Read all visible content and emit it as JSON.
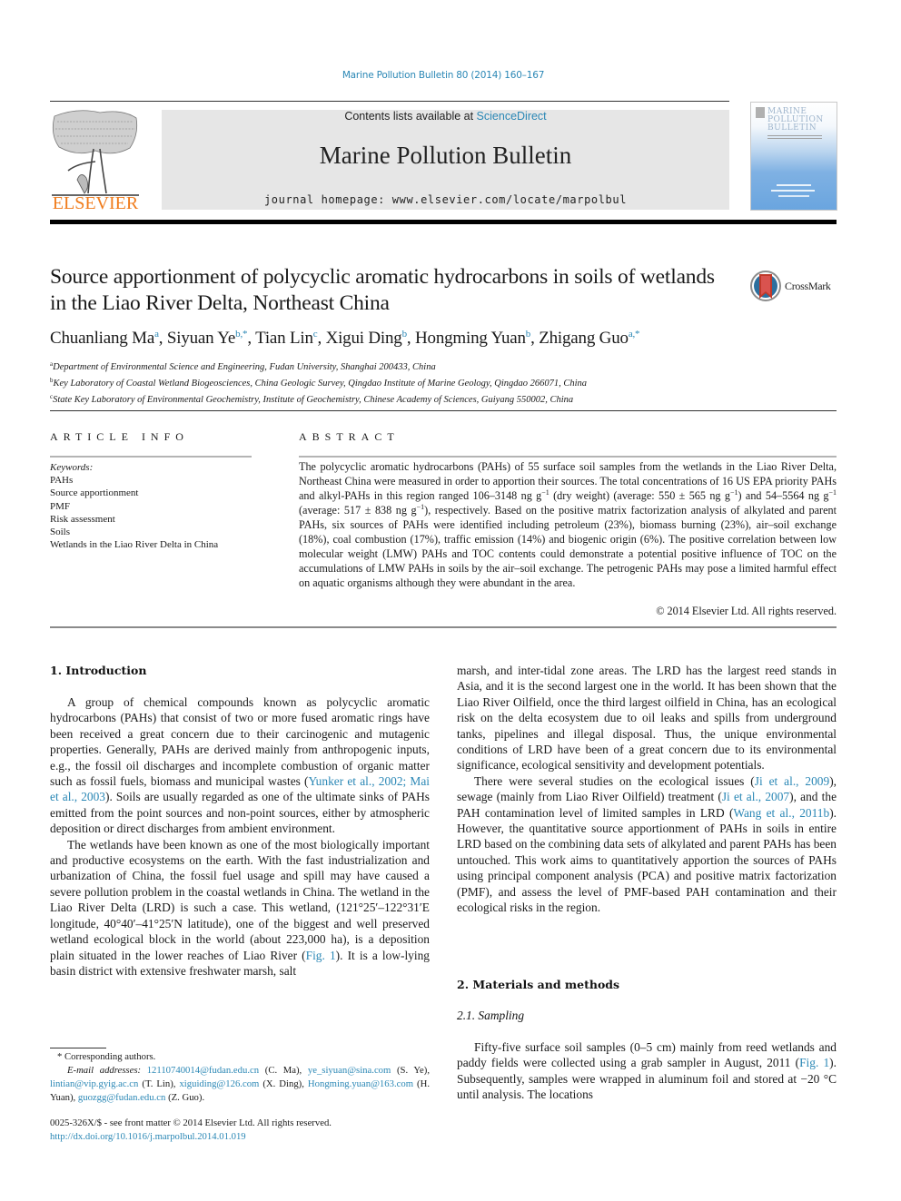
{
  "header": {
    "citation": "Marine Pollution Bulletin 80 (2014) 160–167",
    "contents_prefix": "Contents lists available at ",
    "contents_link": "ScienceDirect",
    "journal_title": "Marine Pollution Bulletin",
    "homepage": "journal homepage: www.elsevier.com/locate/marpolbul",
    "publisher_logo_text": "ELSEVIER",
    "cover_title": "MARINE\nPOLLUTION\nBULLETIN",
    "colors": {
      "link": "#2a87b5",
      "elsevier_orange": "#f07c1c",
      "masthead_bg": "#e6e6e6"
    }
  },
  "article": {
    "title": "Source apportionment of polycyclic aromatic hydrocarbons in soils of wetlands in the Liao River Delta, Northeast China",
    "crossmark_label": "CrossMark",
    "authors": [
      {
        "name": "Chuanliang Ma",
        "sup": "a",
        "sep": ", "
      },
      {
        "name": "Siyuan Ye",
        "sup": "b,*",
        "sep": ", "
      },
      {
        "name": "Tian Lin",
        "sup": "c",
        "sep": ", "
      },
      {
        "name": "Xigui Ding",
        "sup": "b",
        "sep": ", "
      },
      {
        "name": "Hongming Yuan",
        "sup": "b",
        "sep": ", "
      },
      {
        "name": "Zhigang Guo",
        "sup": "a,*",
        "sep": ""
      }
    ],
    "affiliations": [
      {
        "key": "a",
        "text": "Department of Environmental Science and Engineering, Fudan University, Shanghai 200433, China"
      },
      {
        "key": "b",
        "text": "Key Laboratory of Coastal Wetland Biogeosciences, China Geologic Survey, Qingdao Institute of Marine Geology, Qingdao 266071, China"
      },
      {
        "key": "c",
        "text": "State Key Laboratory of Environmental Geochemistry, Institute of Geochemistry, Chinese Academy of Sciences, Guiyang 550002, China"
      }
    ]
  },
  "article_info": {
    "heading": "ARTICLE INFO",
    "keywords_label": "Keywords:",
    "keywords": [
      "PAHs",
      "Source apportionment",
      "PMF",
      "Risk assessment",
      "Soils",
      "Wetlands in the Liao River Delta in China"
    ]
  },
  "abstract": {
    "heading": "ABSTRACT",
    "parts": [
      "The polycyclic aromatic hydrocarbons (PAHs) of 55 surface soil samples from the wetlands in the Liao River Delta, Northeast China were measured in order to apportion their sources. The total concentrations of 16 US EPA priority PAHs and alkyl-PAHs in this region ranged 106–3148 ng g",
      "(dry weight) (average: 550 ± 565 ng g",
      ") and 54–5564 ng g",
      "(average: 517 ± 838 ng g",
      "), respectively. Based on the positive matrix factorization analysis of alkylated and parent PAHs, six sources of PAHs were identified including petroleum (23%), biomass burning (23%), air–soil exchange (18%), coal combustion (17%), traffic emission (14%) and biogenic origin (6%). The positive correlation between low molecular weight (LMW) PAHs and TOC contents could demonstrate a potential positive influence of TOC on the accumulations of LMW PAHs in soils by the air–soil exchange. The petrogenic PAHs may pose a limited harmful effect on aquatic organisms although they were abundant in the area."
    ],
    "unit_sup": "−1",
    "copyright": "© 2014 Elsevier Ltd. All rights reserved."
  },
  "body": {
    "intro_heading": "1. Introduction",
    "intro_p1": [
      "A group of chemical compounds known as polycyclic aromatic hydrocarbons (PAHs) that consist of two or more fused aromatic rings have been received a great concern due to their carcinogenic and mutagenic properties. Generally, PAHs are derived mainly from anthropogenic inputs, e.g., the fossil oil discharges and incomplete combustion of organic matter such as fossil fuels, biomass and municipal wastes (",
      "Yunker et al., 2002; Mai et al., 2003",
      "). Soils are usually regarded as one of the ultimate sinks of PAHs emitted from the point sources and non-point sources, either by atmospheric deposition or direct discharges from ambient environment."
    ],
    "intro_p2": [
      "The wetlands have been known as one of the most biologically important and productive ecosystems on the earth. With the fast industrialization and urbanization of China, the fossil fuel usage and spill may have caused a severe pollution problem in the coastal wetlands in China. The wetland in the Liao River Delta (LRD) is such a case. This wetland, (121°25′–122°31′E longitude, 40°40′–41°25′N latitude), one of the biggest and well preserved wetland ecological block in the world (about 223,000 ha), is a deposition plain situated in the lower reaches of Liao River (",
      "Fig. 1",
      "). It is a low-lying basin district with extensive freshwater marsh, salt"
    ],
    "right_p1": "marsh, and inter-tidal zone areas. The LRD has the largest reed stands in Asia, and it is the second largest one in the world. It has been shown that the Liao River Oilfield, once the third largest oilfield in China, has an ecological risk on the delta ecosystem due to oil leaks and spills from underground tanks, pipelines and illegal disposal. Thus, the unique environmental conditions of LRD have been of a great concern due to its environmental significance, ecological sensitivity and development potentials.",
    "right_p2": [
      "There were several studies on the ecological issues (",
      "Ji et al., 2009",
      "), sewage (mainly from Liao River Oilfield) treatment (",
      "Ji et al., 2007",
      "), and the PAH contamination level of limited samples in LRD (",
      "Wang et al., 2011b",
      "). However, the quantitative source apportionment of PAHs in soils in entire LRD based on the combining data sets of alkylated and parent PAHs has been untouched. This work aims to quantitatively apportion the sources of PAHs using principal component analysis (PCA) and positive matrix factorization (PMF), and assess the level of PMF-based PAH contamination and their ecological risks in the region."
    ],
    "methods_heading": "2. Materials and methods",
    "sampling_heading": "2.1. Sampling",
    "sampling_p1": [
      "Fifty-five surface soil samples (0–5 cm) mainly from reed wetlands and paddy fields were collected using a grab sampler in August, 2011 (",
      "Fig. 1",
      "). Subsequently, samples were wrapped in aluminum foil and stored at −20 °C until analysis. The locations"
    ]
  },
  "footnotes": {
    "corresponding": "* Corresponding authors.",
    "email_label": "E-mail addresses:",
    "emails": [
      {
        "address": "12110740014@fudan.edu.cn",
        "who": " (C. Ma), "
      },
      {
        "address": "ye_siyuan@sina.com",
        "who": " (S. Ye), "
      },
      {
        "address": "lintian@vip.gyig.ac.cn",
        "who": " (T. Lin), "
      },
      {
        "address": "xiguiding@126.com",
        "who": " (X. Ding), "
      },
      {
        "address": "Hongming.yuan@163.com",
        "who": " (H. Yuan), "
      },
      {
        "address": "guozgg@fudan.edu.cn",
        "who": " (Z. Guo)."
      }
    ],
    "front_matter": "0025-326X/$ - see front matter © 2014 Elsevier Ltd. All rights reserved.",
    "doi": "http://dx.doi.org/10.1016/j.marpolbul.2014.01.019"
  }
}
